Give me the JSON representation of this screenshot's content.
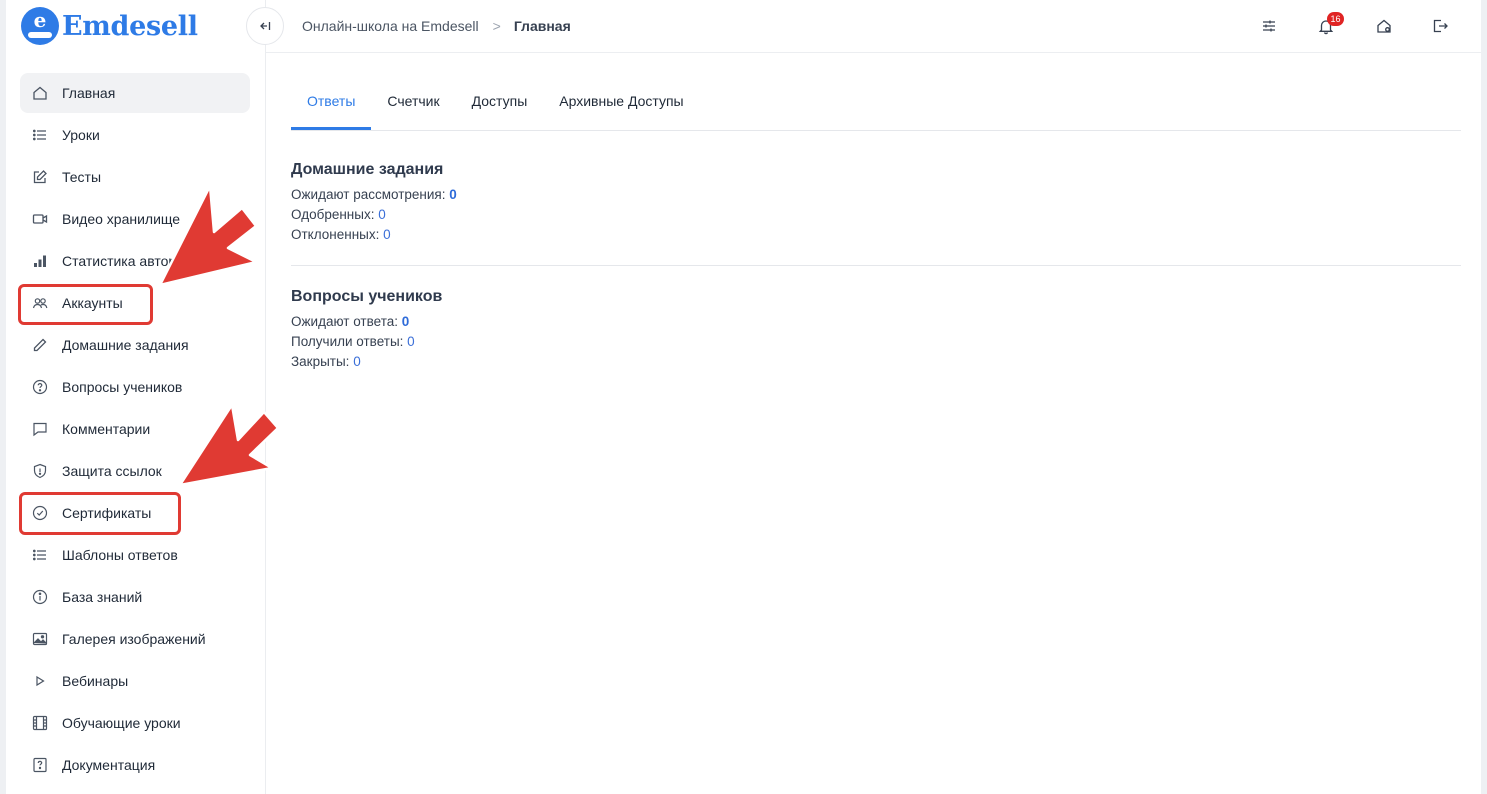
{
  "brand": {
    "name": "Emdesell",
    "mark_letter": "e",
    "color": "#2e7be6"
  },
  "breadcrumb": {
    "school": "Онлайн-школа на Emdesell",
    "current": "Главная"
  },
  "notifications": {
    "count": "16"
  },
  "sidebar": {
    "items": [
      {
        "label": "Главная",
        "icon": "home-icon"
      },
      {
        "label": "Уроки",
        "icon": "list-icon"
      },
      {
        "label": "Тесты",
        "icon": "edit-icon"
      },
      {
        "label": "Видео хранилище",
        "icon": "video-icon"
      },
      {
        "label": "Статистика авторов",
        "icon": "bar-chart-icon"
      },
      {
        "label": "Аккаунты",
        "icon": "users-icon"
      },
      {
        "label": "Домашние задания",
        "icon": "pencil-icon"
      },
      {
        "label": "Вопросы учеников",
        "icon": "question-icon"
      },
      {
        "label": "Комментарии",
        "icon": "comment-icon"
      },
      {
        "label": "Защита ссылок",
        "icon": "shield-icon"
      },
      {
        "label": "Сертификаты",
        "icon": "check-circle-icon"
      },
      {
        "label": "Шаблоны ответов",
        "icon": "list-icon"
      },
      {
        "label": "База знаний",
        "icon": "info-icon"
      },
      {
        "label": "Галерея изображений",
        "icon": "image-icon"
      },
      {
        "label": "Вебинары",
        "icon": "play-icon"
      },
      {
        "label": "Обучающие уроки",
        "icon": "film-icon"
      },
      {
        "label": "Документация",
        "icon": "doc-question-icon"
      }
    ]
  },
  "tabs": [
    "Ответы",
    "Счетчик",
    "Доступы",
    "Архивные Доступы"
  ],
  "homework": {
    "title": "Домашние задания",
    "pending_label": "Ожидают рассмотрения:",
    "pending": "0",
    "approved_label": "Одобренных:",
    "approved": "0",
    "rejected_label": "Отклоненных:",
    "rejected": "0"
  },
  "questions": {
    "title": "Вопросы учеников",
    "waiting_label": "Ожидают ответа:",
    "waiting": "0",
    "answered_label": "Получили ответы:",
    "answered": "0",
    "closed_label": "Закрыты:",
    "closed": "0"
  },
  "annotation_color": "#e03a33"
}
